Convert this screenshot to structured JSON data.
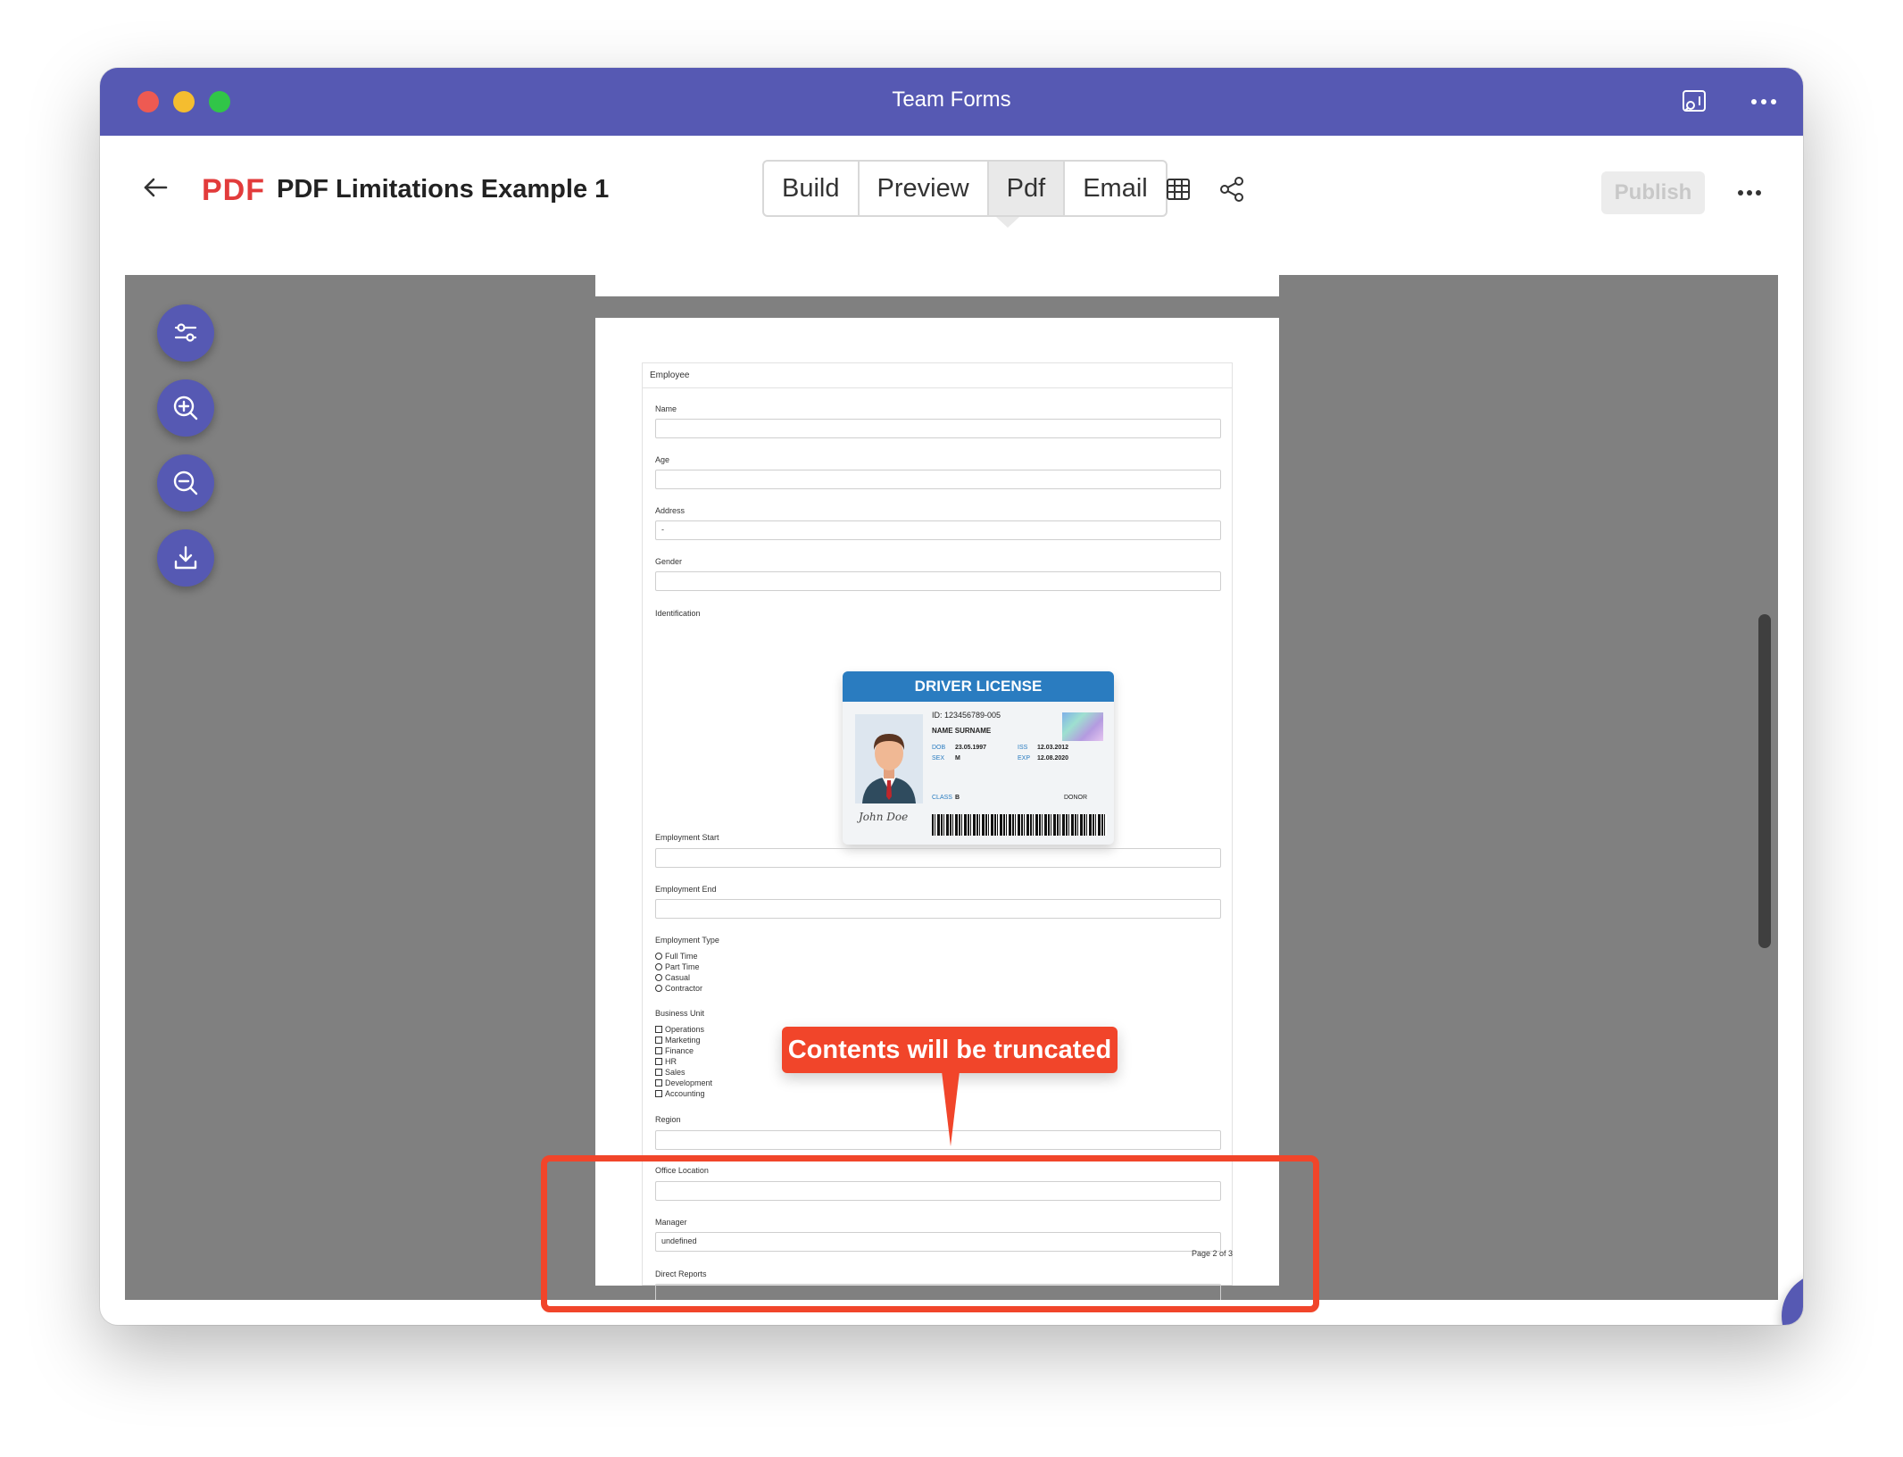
{
  "window": {
    "title": "Team Forms"
  },
  "toolbar": {
    "logo_text": "PDF",
    "doc_title": "PDF Limitations Example 1",
    "tabs": [
      {
        "label": "Build"
      },
      {
        "label": "Preview"
      },
      {
        "label": "Pdf"
      },
      {
        "label": "Email"
      }
    ],
    "active_tab": "Pdf",
    "publish_label": "Publish"
  },
  "viewer_tools": [
    "settings-sliders-icon",
    "zoom-in-icon",
    "zoom-out-icon",
    "download-icon"
  ],
  "form": {
    "section": "Employee",
    "fields": {
      "name": {
        "label": "Name",
        "value": ""
      },
      "age": {
        "label": "Age",
        "value": ""
      },
      "address": {
        "label": "Address",
        "value": "-"
      },
      "gender": {
        "label": "Gender",
        "value": ""
      },
      "identification": {
        "label": "Identification"
      },
      "employment_start": {
        "label": "Employment Start",
        "value": ""
      },
      "employment_end": {
        "label": "Employment End",
        "value": ""
      },
      "employment_type": {
        "label": "Employment Type",
        "options": [
          "Full Time",
          "Part Time",
          "Casual",
          "Contractor"
        ]
      },
      "business_unit": {
        "label": "Business Unit",
        "options": [
          "Operations",
          "Marketing",
          "Finance",
          "HR",
          "Sales",
          "Development",
          "Accounting"
        ]
      },
      "region": {
        "label": "Region",
        "value": ""
      },
      "office_location": {
        "label": "Office Location",
        "value": ""
      },
      "manager": {
        "label": "Manager",
        "value": "undefined"
      },
      "direct_reports": {
        "label": "Direct Reports"
      }
    },
    "page_indicator": "Page 2 of 3"
  },
  "license": {
    "title": "DRIVER LICENSE",
    "id": "ID: 123456789-005",
    "name": "NAME SURNAME",
    "dob_label": "DOB",
    "dob": "23.05.1997",
    "sex_label": "SEX",
    "sex": "M",
    "iss_label": "ISS",
    "iss": "12.03.2012",
    "exp_label": "EXP",
    "exp": "12.08.2020",
    "class_label": "CLASS",
    "class": "B",
    "donor_label": "DONOR",
    "signature": "John Doe"
  },
  "annotation": {
    "text": "Contents will be truncated",
    "color": "#f1452a"
  },
  "colors": {
    "brand": "#5659b3",
    "viewer_bg": "#808080"
  }
}
